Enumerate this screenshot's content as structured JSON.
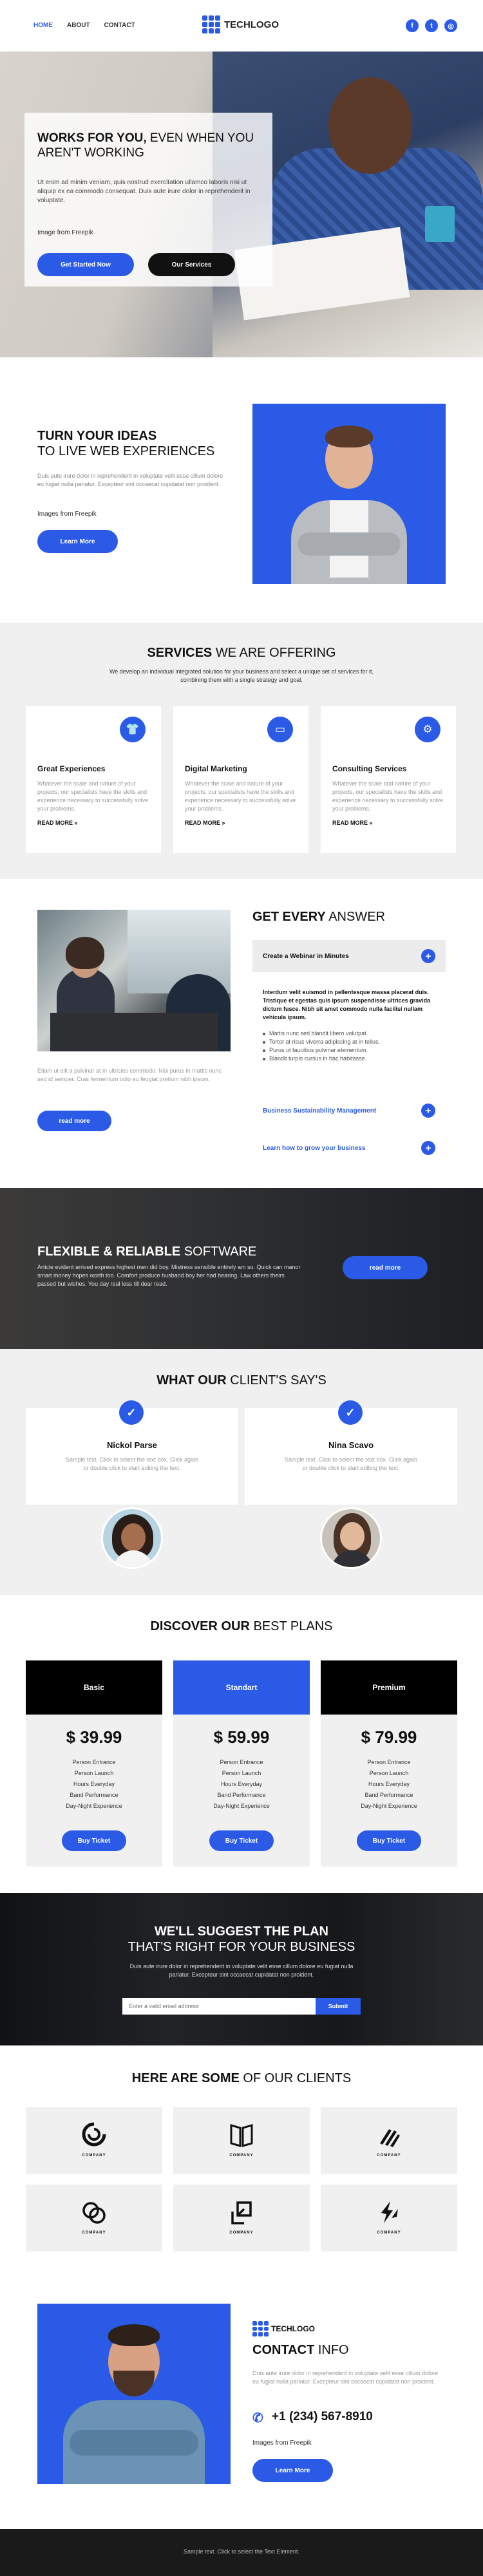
{
  "nav": {
    "links": [
      "HOME",
      "ABOUT",
      "CONTACT"
    ],
    "logo_text": "TECHLOGO",
    "social": [
      {
        "icon": "facebook-icon",
        "glyph": "f"
      },
      {
        "icon": "twitter-icon",
        "glyph": "t"
      },
      {
        "icon": "instagram-icon",
        "glyph": "◎"
      }
    ]
  },
  "hero": {
    "title_bold": "WORKS FOR YOU,",
    "title_rest": " EVEN WHEN YOU AREN'T WORKING",
    "text": "Ut enim ad minim veniam, quis nostrud exercitation ullamco laboris nisi ut aliquip ex ea commodo consequat. Duis aute irure dolor in reprehenderit in voluptate.",
    "credit_prefix": "Image from ",
    "credit_link": "Freepik",
    "primary_button": "Get Started Now",
    "secondary_button": "Our Services"
  },
  "ideas": {
    "title_bold": "TURN YOUR IDEAS",
    "title_rest": "TO LIVE WEB EXPERIENCES",
    "text": "Duis aute irure dolor in reprehenderit in voluptate velit esse cillum dolore eu fugiat nulla pariatur. Excepteur sint occaecat cupidatat non proident.",
    "credit_prefix": "Images from ",
    "credit_link": "Freepik",
    "button": "Learn More"
  },
  "services": {
    "title_bold": "SERVICES",
    "title_rest": " WE ARE OFFERING",
    "subtitle": "We develop an individual integrated solution for your business and select a unique set of services for it, combining them with a single strategy and goal.",
    "cards": [
      {
        "icon": "shirt-icon",
        "glyph": "👕",
        "title": "Great Experiences",
        "text": "Whatever the scale and nature of your projects, our specialists have the skills and experience necessary to successfully solve your problems.",
        "more": "READ MORE »"
      },
      {
        "icon": "monitor-icon",
        "glyph": "▭",
        "title": "Digital Marketing",
        "text": "Whatever the scale and nature of your projects, our specialists have the skills and experience necessary to successfully solve your problems.",
        "more": "READ MORE »"
      },
      {
        "icon": "gear-icon",
        "glyph": "⚙",
        "title": "Consulting Services",
        "text": "Whatever the scale and nature of your projects, our specialists have the skills and experience necessary to successfully solve your problems.",
        "more": "READ MORE »"
      }
    ]
  },
  "answer": {
    "text": "Etiam ut elit a pulvinar at in ultricies commodo. Nisi purus in mattis nunc sed id semper. Cras fermentum odio eu feugiat pretium nibh ipsum.",
    "button": "read more",
    "title_bold": "GET EVERY",
    "title_rest": " ANSWER",
    "items": [
      {
        "label": "Create a Webinar in Minutes"
      },
      {
        "label": "Business Sustainability Management"
      },
      {
        "label": "Learn how to grow your business"
      }
    ],
    "open_bold": "Interdum velit euismod in pellentesque massa placerat duis. Tristique et egestas quis ipsum suspendisse ultrices gravida dictum fusce. Nibh sit amet commodo nulla facilisi nullam vehicula ipsum.",
    "open_list": [
      "Mattis nunc sed blandit libero volutpat.",
      "Tortor at risus viverra adipiscing at in tellus.",
      "Purus ut faucibus pulvinar elementum.",
      "Blandit turpis cursus in hac habitasse."
    ]
  },
  "flexible": {
    "title_bold": "FLEXIBLE & RELIABLE",
    "title_rest": " SOFTWARE",
    "text": "Article evident arrived express highest men did boy. Mistress sensible entirely am so. Quick can manor smart money hopes worth too. Comfort produce husband boy her had hearing. Law others theirs passed but wishes. You day real less till dear read.",
    "button": "read more"
  },
  "testimonials": {
    "title_bold": "WHAT OUR",
    "title_rest": " CLIENT'S SAY'S",
    "items": [
      {
        "name": "Nickol Parse",
        "quote": "Sample text. Click to select the text box. Click again or double click to start editing the text."
      },
      {
        "name": "Nina Scavo",
        "quote": "Sample text. Click to select the text box. Click again or double click to start editing the text."
      }
    ]
  },
  "plans": {
    "title_bold": "DISCOVER OUR",
    "title_rest": " BEST PLANS",
    "items": [
      {
        "name": "Basic",
        "price": "$ 39.99",
        "features": [
          "Person Entrance",
          "Person Launch",
          "Hours Everyday",
          "Band Performance",
          "Day-Night Experience"
        ],
        "button": "Buy Ticket"
      },
      {
        "name": "Standart",
        "price": "$ 59.99",
        "features": [
          "Person Entrance",
          "Person Launch",
          "Hours Everyday",
          "Band Performance",
          "Day-Night Experience"
        ],
        "button": "Buy Ticket"
      },
      {
        "name": "Premium",
        "price": "$ 79.99",
        "features": [
          "Person Entrance",
          "Person Launch",
          "Hours Everyday",
          "Band Performance",
          "Day-Night Experience"
        ],
        "button": "Buy Ticket"
      }
    ]
  },
  "suggest": {
    "line1": "WE'LL SUGGEST THE PLAN",
    "line2": "THAT'S RIGHT FOR YOUR BUSINESS",
    "text": "Duis aute irure dolor in reprehenderit in voluptate velit esse cillum dolore eu fugiat nulla pariatur. Excepteur sint occaecat cupidatat non proident.",
    "email_placeholder": "Enter a valid email address",
    "submit": "Submit"
  },
  "clients": {
    "title_bold": "HERE ARE SOME",
    "title_rest": " OF OUR CLIENTS",
    "logos": [
      "COMPANY",
      "COMPANY",
      "COMPANY",
      "COMPANY",
      "COMPANY",
      "COMPANY"
    ]
  },
  "contact": {
    "logo_text": "TECHLOGO",
    "title_bold": "CONTACT",
    "title_rest": " INFO",
    "text": "Duis aute irure dolor in reprehenderit in voluptate velit esse cillum dolore eu fugiat nulla pariatur. Excepteur sint occaecat cupidatat non proident.",
    "phone": "+1 (234) 567-8910",
    "credit_prefix": "Images from ",
    "credit_link": "Freepik",
    "button": "Learn More"
  },
  "footer": {
    "text": "Sample text. Click to select the Text Element."
  },
  "colors": {
    "accent": "#2b5be6",
    "dark": "#111111",
    "section_gray": "#f0f0f0",
    "footer": "#1a1a1a"
  }
}
